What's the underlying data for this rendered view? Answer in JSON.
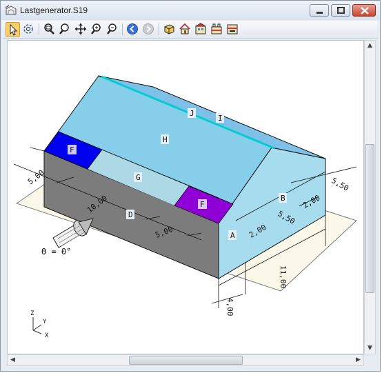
{
  "window": {
    "title": "Lastgenerator.S19"
  },
  "toolbar": {
    "icons": [
      "pointer-icon",
      "rotate-view-icon",
      "zoom-window-icon",
      "zoom-icon",
      "pan-icon",
      "zoom-in-icon",
      "zoom-out-icon",
      "back-icon",
      "forward-icon",
      "3d-view-icon",
      "house-icon",
      "structure-icon",
      "building-icon",
      "section-icon"
    ]
  },
  "drawing": {
    "face_labels": {
      "J": "J",
      "I": "I",
      "H": "H",
      "F1": "F",
      "F2": "F",
      "G": "G",
      "D": "D",
      "B": "B",
      "A": "A"
    },
    "dimensions": {
      "d_5_00_left": "5,00",
      "d_10_00": "10,00",
      "d_5_00_front": "5,00",
      "d_5_50_right": "5,50",
      "d_2_00_b": "2,00",
      "d_5_50_b": "5,50",
      "d_2_00_a": "2,00",
      "d_11_00": "11,00",
      "d_4_00": "4,00"
    },
    "wind_direction": "Θ = 0°",
    "axes": {
      "z": "Z",
      "y": "Y",
      "x": "X"
    },
    "colors": {
      "roof": "#87ceeb",
      "roof_zone_f_left": "#0000ee",
      "roof_zone_f_right": "#8f00d6",
      "roof_zone_g": "#add8e6",
      "ridge": "#00ced1",
      "wall_d": "#7c7c7c",
      "gable_wall": "#a6dcee",
      "ground": "#fbf8ea"
    }
  }
}
